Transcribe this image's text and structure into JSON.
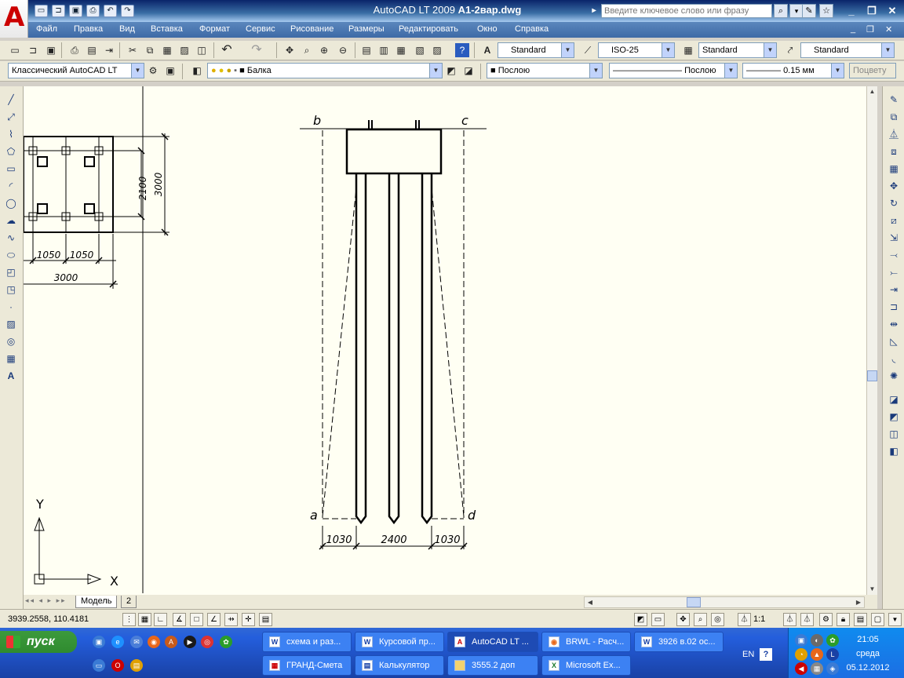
{
  "window": {
    "app": "AutoCAD LT 2009",
    "file": "A1-2вар.dwg",
    "search_placeholder": "Введите ключевое слово или фразу"
  },
  "menu": [
    "Файл",
    "Правка",
    "Вид",
    "Вставка",
    "Формат",
    "Сервис",
    "Рисование",
    "Размеры",
    "Редактировать",
    "Окно",
    "Справка"
  ],
  "styles_toolbar": {
    "text_style": "Standard",
    "dim_style": "ISO-25",
    "table_style": "Standard",
    "mleader_style": "Standard"
  },
  "layers_toolbar": {
    "workspace": "Классический AutoCAD LT",
    "layer": "Балка",
    "color": "Послою",
    "linetype": "Послою",
    "lineweight": "0.15 мм",
    "plot_style": "Поцвету"
  },
  "drawing": {
    "plan_dims": {
      "y_inner": "2100",
      "y_outer": "3000",
      "x_1": "1050",
      "x_2": "1050",
      "x_total": "3000"
    },
    "elevation_labels": {
      "b": "b",
      "c": "c",
      "a": "a",
      "d": "d"
    },
    "elevation_dims": {
      "left": "1030",
      "mid": "2400",
      "right": "1030"
    },
    "ucs": {
      "x": "X",
      "y": "Y"
    }
  },
  "layout_tabs": {
    "model": "Модель",
    "layout2": "2"
  },
  "status": {
    "coords": "3939.2558, 110.4181",
    "scale": "1:1"
  },
  "taskbar": {
    "start": "пуск",
    "row1": [
      "схема и раз...",
      "Курсовой пр...",
      "AutoCAD LT ...",
      "BRWL - Расч...",
      "3926 в.02 ос..."
    ],
    "row2": [
      "ГРАНД-Смета",
      "Калькулятор",
      "3555.2  доп",
      "Microsoft Ex..."
    ],
    "lang": "EN",
    "time": "21:05",
    "day": "среда",
    "date": "05.12.2012"
  }
}
